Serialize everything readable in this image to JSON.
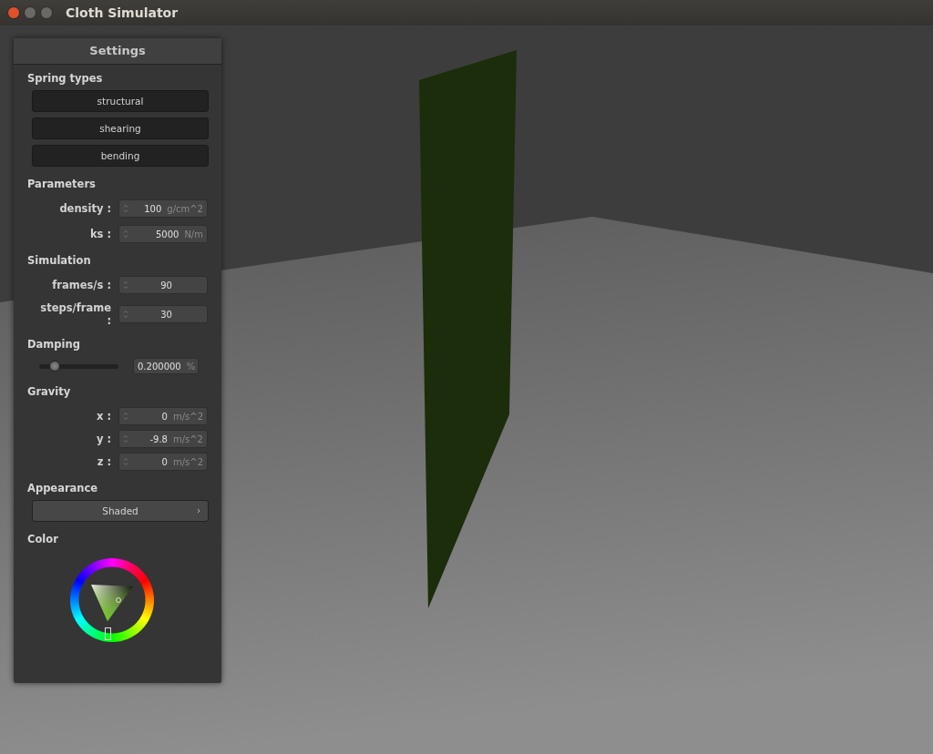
{
  "window": {
    "title": "Cloth Simulator"
  },
  "panel": {
    "title": "Settings",
    "sections": [
      {
        "kind": "buttons",
        "title": "Spring types",
        "buttons": [
          "structural",
          "shearing",
          "bending"
        ]
      },
      {
        "kind": "fields",
        "title": "Parameters",
        "fields": [
          {
            "label": "density :",
            "value": "100",
            "unit": "g/cm^2"
          },
          {
            "label": "ks :",
            "value": "5000",
            "unit": "N/m"
          }
        ]
      },
      {
        "kind": "fields",
        "title": "Simulation",
        "fields": [
          {
            "label": "frames/s :",
            "value": "90"
          },
          {
            "label": "steps/frame :",
            "value": "30"
          }
        ]
      },
      {
        "kind": "slider",
        "title": "Damping",
        "level": 0.2,
        "value": "0.200000",
        "unit": "%"
      },
      {
        "kind": "fields",
        "title": "Gravity",
        "fields": [
          {
            "label": "x :",
            "value": "0",
            "unit": "m/s^2"
          },
          {
            "label": "y :",
            "value": "-9.8",
            "unit": "m/s^2"
          },
          {
            "label": "z :",
            "value": "0",
            "unit": "m/s^2"
          }
        ]
      },
      {
        "kind": "dropdown",
        "title": "Appearance",
        "value": "Shaded"
      },
      {
        "kind": "color",
        "title": "Color"
      }
    ]
  }
}
